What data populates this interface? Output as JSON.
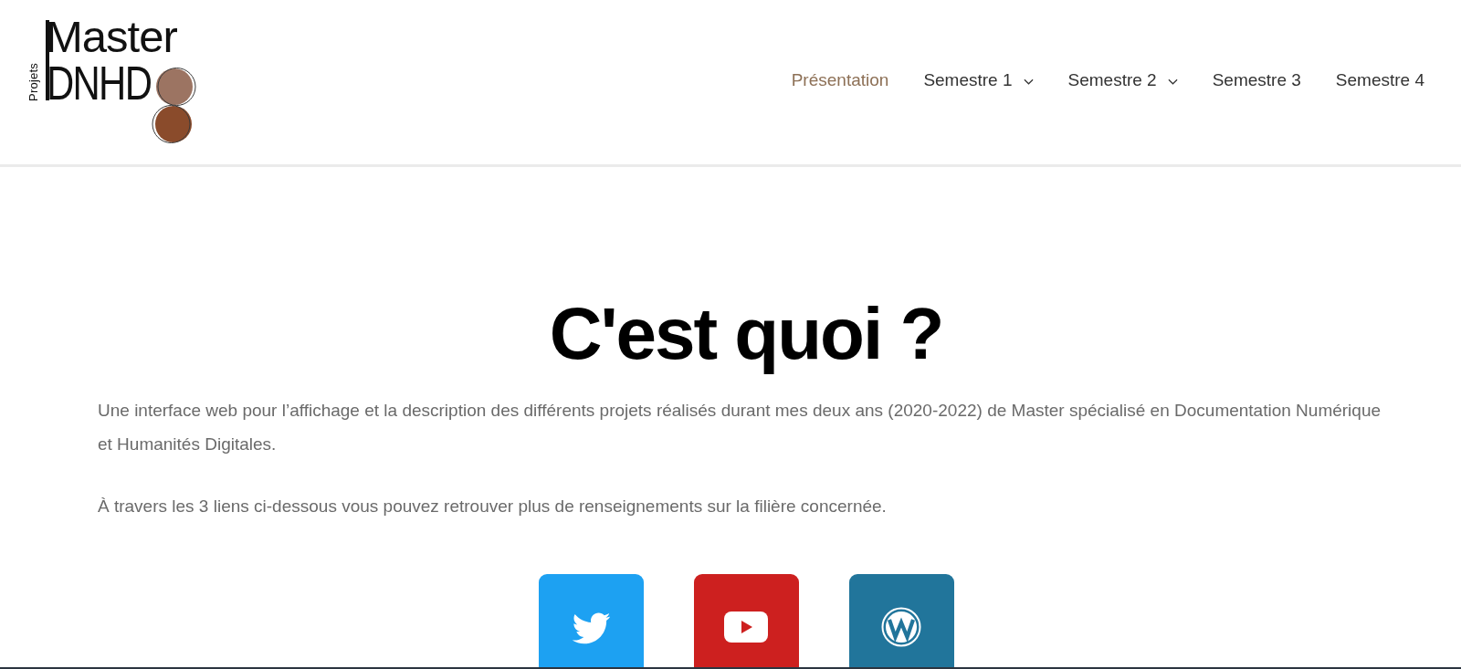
{
  "logo": {
    "title": "Master",
    "subtitle": "DNHD",
    "side_label": "Projets"
  },
  "nav": [
    {
      "label": "Présentation",
      "selected": true,
      "dropdown": false
    },
    {
      "label": "Semestre 1",
      "selected": false,
      "dropdown": true
    },
    {
      "label": "Semestre 2",
      "selected": false,
      "dropdown": true
    },
    {
      "label": "Semestre 3",
      "selected": false,
      "dropdown": false
    },
    {
      "label": "Semestre 4",
      "selected": false,
      "dropdown": false
    }
  ],
  "intro": {
    "heading": "C'est quoi ?",
    "paragraphs": [
      "Une interface web pour l’affichage et la description des différents projets réalisés durant mes deux ans (2020-2022) de Master spécialisé en Documentation Numérique et Humanités Digitales.",
      "À travers les 3 liens ci-dessous vous pouvez retrouver plus de renseignements sur la filière concernée."
    ]
  },
  "social_links": [
    {
      "kind": "twitter",
      "color": "#1da1f2"
    },
    {
      "kind": "youtube",
      "color": "#cd201f"
    },
    {
      "kind": "wordpress",
      "color": "#21759b"
    }
  ]
}
